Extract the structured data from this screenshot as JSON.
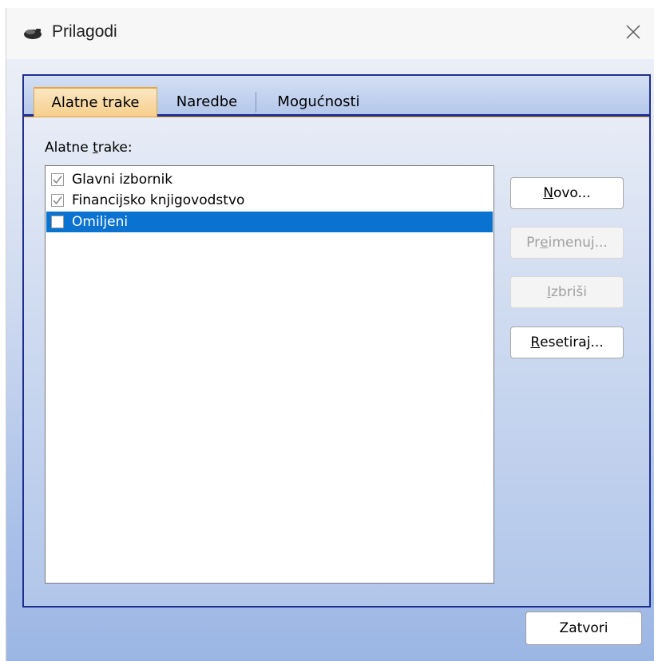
{
  "window": {
    "title": "Prilagodi",
    "icon": "app-icon",
    "close_icon": "close-icon"
  },
  "tabs": [
    {
      "label": "Alatne trake",
      "active": true
    },
    {
      "label": "Naredbe",
      "active": false
    },
    {
      "label": "Mogućnosti",
      "active": false
    }
  ],
  "toolbars_panel": {
    "label_pre": "Alatne ",
    "label_ul": "t",
    "label_post": "rake:",
    "items": [
      {
        "label": "Glavni izbornik",
        "checked": true,
        "selected": false
      },
      {
        "label": "Financijsko knjigovodstvo",
        "checked": true,
        "selected": false
      },
      {
        "label": "Omiljeni",
        "checked": false,
        "selected": true
      }
    ]
  },
  "buttons": {
    "new": {
      "ul": "N",
      "rest": "ovo...",
      "enabled": true
    },
    "rename": {
      "pre": "Pr",
      "ul": "e",
      "rest": "imenuj...",
      "enabled": false
    },
    "delete": {
      "ul": "I",
      "rest": "zbriši",
      "enabled": false
    },
    "reset": {
      "ul": "R",
      "rest": "esetiraj...",
      "enabled": true
    }
  },
  "footer": {
    "close_label": "Zatvori"
  },
  "colors": {
    "selection": "#0a72d0",
    "frame": "#1f2f8f",
    "active_tab": "#f6cf8c"
  }
}
